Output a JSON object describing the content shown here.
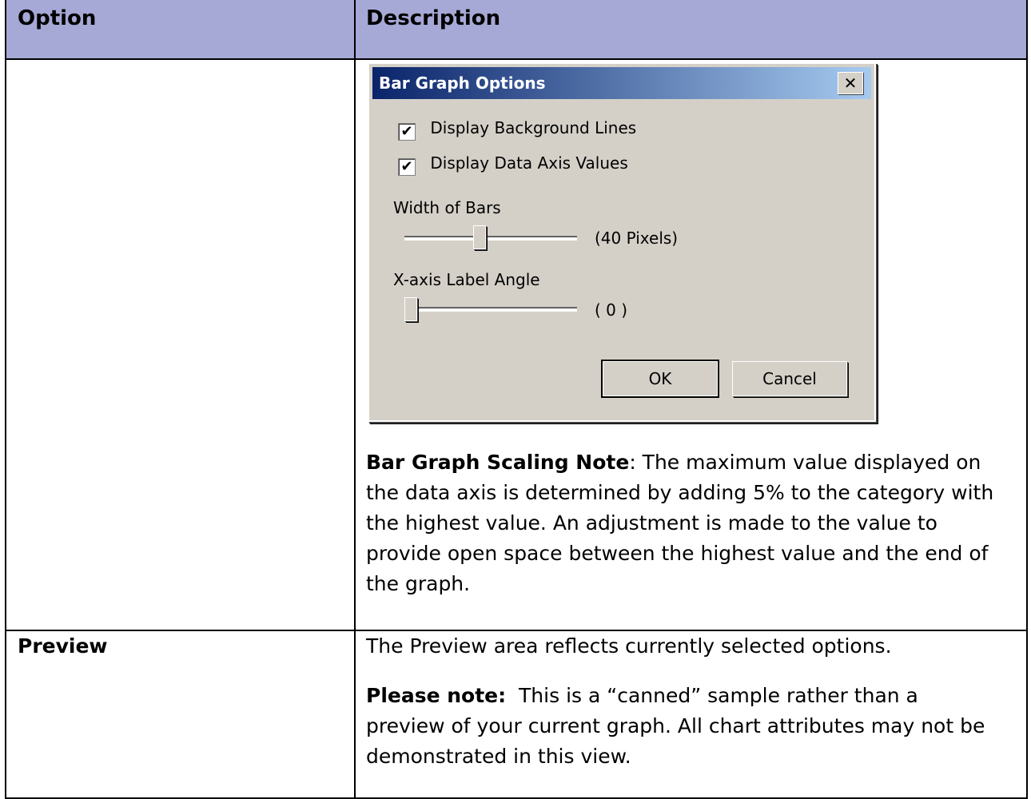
{
  "header": {
    "col1": "Option",
    "col2": "Description"
  },
  "dialog": {
    "title": "Bar Graph Options",
    "close_label": "✕",
    "check1": {
      "label": "Display Background Lines",
      "checked": true
    },
    "check2": {
      "label": "Display Data Axis Values",
      "checked": true
    },
    "width_label": "Width of Bars",
    "width_value_text": "(40 Pixels)",
    "width_fraction": 0.4,
    "angle_label": "X-axis Label Angle",
    "angle_value_text": "( 0 )",
    "angle_fraction": 0.0,
    "ok_label": "OK",
    "cancel_label": "Cancel"
  },
  "note": {
    "bold": "Bar Graph Scaling Note",
    "lines": [
      ": The maximum value displayed on",
      "the data axis is determined by adding 5% to the category with",
      "the highest value.  An adjustment is made to the value to",
      "provide open space between the highest value and the end of",
      "the graph."
    ]
  },
  "preview": {
    "option": "Preview",
    "desc1": "The Preview area reflects currently selected options.",
    "note_bold": "Please note:",
    "note_lines": [
      "  This is a “canned” sample rather than a",
      "preview of your current graph.  All chart attributes may not be",
      "demonstrated in this view."
    ]
  }
}
